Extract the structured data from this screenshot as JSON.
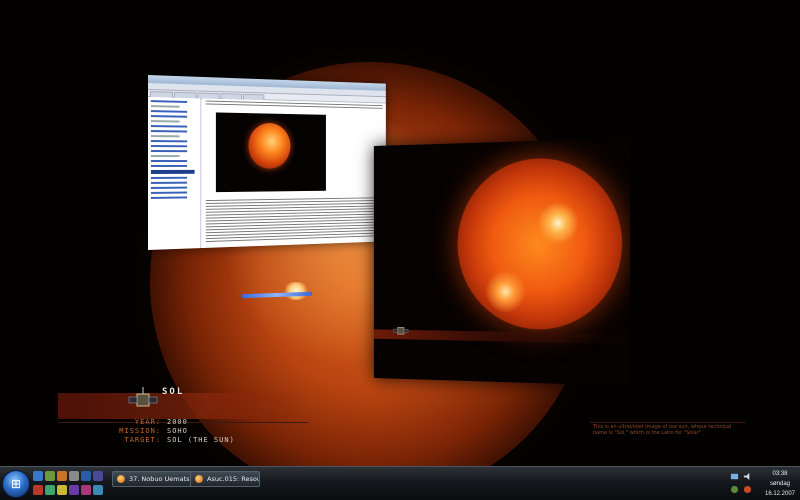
{
  "wallpaper": {
    "title": "SOL",
    "mission_rows": [
      {
        "label": "YEAR:",
        "value": "2000"
      },
      {
        "label": "MISSION:",
        "value": "SOHO"
      },
      {
        "label": "TARGET:",
        "value": "SOL (THE SUN)"
      }
    ],
    "caption": "This is an ultraviolet image of our sun, whose technical name is \"Sol,\" which is the Latin for \"Solar\""
  },
  "taskbar": {
    "windows": [
      {
        "label": "37. Nobuo Uematsu - ..."
      },
      {
        "label": "Asuc.015: Resource ..."
      }
    ],
    "clock": {
      "time": "03:38",
      "day": "søndag",
      "date": "16.12.2007"
    }
  },
  "colors": {
    "taskbar": "#14181c",
    "sun_core": "#ef5a10",
    "accent_text": "#c96a2a"
  }
}
